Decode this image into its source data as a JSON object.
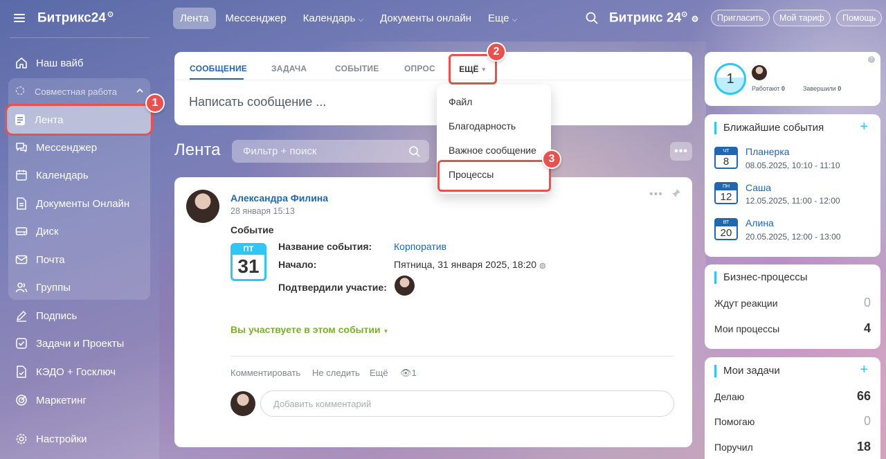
{
  "app": {
    "logo": "Битрикс",
    "logo_num": "24",
    "logo_sup": "⊙"
  },
  "sidebar": {
    "group_label": "Совместная работа",
    "items": [
      {
        "label": "Наш вайб"
      },
      {
        "label": "Лента"
      },
      {
        "label": "Мессенджер"
      },
      {
        "label": "Календарь"
      },
      {
        "label": "Документы Онлайн"
      },
      {
        "label": "Диск"
      },
      {
        "label": "Почта"
      },
      {
        "label": "Группы"
      },
      {
        "label": "Подпись"
      },
      {
        "label": "Задачи и Проекты"
      },
      {
        "label": "КЭДО + Госключ"
      },
      {
        "label": "Маркетинг"
      },
      {
        "label": "Настройки"
      }
    ]
  },
  "topbar": {
    "tabs": [
      "Лента",
      "Мессенджер",
      "Календарь",
      "Документы онлайн",
      "Еще"
    ],
    "logo": "Битрикс 24",
    "invite": "Пригласить",
    "tariff": "Мой тариф",
    "help": "Помощь"
  },
  "composer": {
    "tabs": [
      "СООБЩЕНИЕ",
      "ЗАДАЧА",
      "СОБЫТИЕ",
      "ОПРОС"
    ],
    "more": "ЕЩЁ",
    "placeholder": "Написать сообщение ..."
  },
  "dropdown": {
    "items": [
      "Файл",
      "Благодарность",
      "Важное сообщение",
      "Процессы"
    ]
  },
  "badges": [
    "1",
    "2",
    "3"
  ],
  "feed": {
    "title": "Лента",
    "filter_placeholder": "Фильтр + поиск"
  },
  "post": {
    "author": "Александра Филина",
    "date": "28 января 15:13",
    "type": "Событие",
    "cal_day": "ПТ",
    "cal_num": "31",
    "fields": [
      {
        "label": "Название события:",
        "value": "Корпоратив"
      },
      {
        "label": "Начало:",
        "value": "Пятница, 31 января 2025, 18:20"
      },
      {
        "label": "Подтвердили участие:",
        "value": ""
      }
    ],
    "participation": "Вы участвуете в этом событии",
    "actions": {
      "comment": "Комментировать",
      "unfollow": "Не следить",
      "more": "Ещё",
      "views": "1"
    },
    "comment_placeholder": "Добавить комментарий"
  },
  "widgets": {
    "stats": {
      "count": "1",
      "working_label": "Работают",
      "working": "0",
      "done_label": "Завершили",
      "done": "0"
    },
    "events": {
      "title": "Ближайшие события",
      "items": [
        {
          "dow": "ЧТ",
          "day": "8",
          "name": "Планерка",
          "time": "08.05.2025, 10:10 - 11:10"
        },
        {
          "dow": "ПН",
          "day": "12",
          "name": "Саша",
          "time": "12.05.2025, 11:00 - 12:00"
        },
        {
          "dow": "ВТ",
          "day": "20",
          "name": "Алина",
          "time": "20.05.2025, 12:00 - 13:00"
        }
      ]
    },
    "bp": {
      "title": "Бизнес-процессы",
      "rows": [
        {
          "label": "Ждут реакции",
          "value": "0"
        },
        {
          "label": "Мои процессы",
          "value": "4"
        }
      ]
    },
    "tasks": {
      "title": "Мои задачи",
      "rows": [
        {
          "label": "Делаю",
          "value": "66"
        },
        {
          "label": "Помогаю",
          "value": "0"
        },
        {
          "label": "Поручил",
          "value": "18"
        }
      ]
    }
  },
  "colors": {
    "accent": "#2067b0",
    "highlight": "#e8514d",
    "cyan": "#2fc6f6",
    "green": "#7ab02d"
  }
}
